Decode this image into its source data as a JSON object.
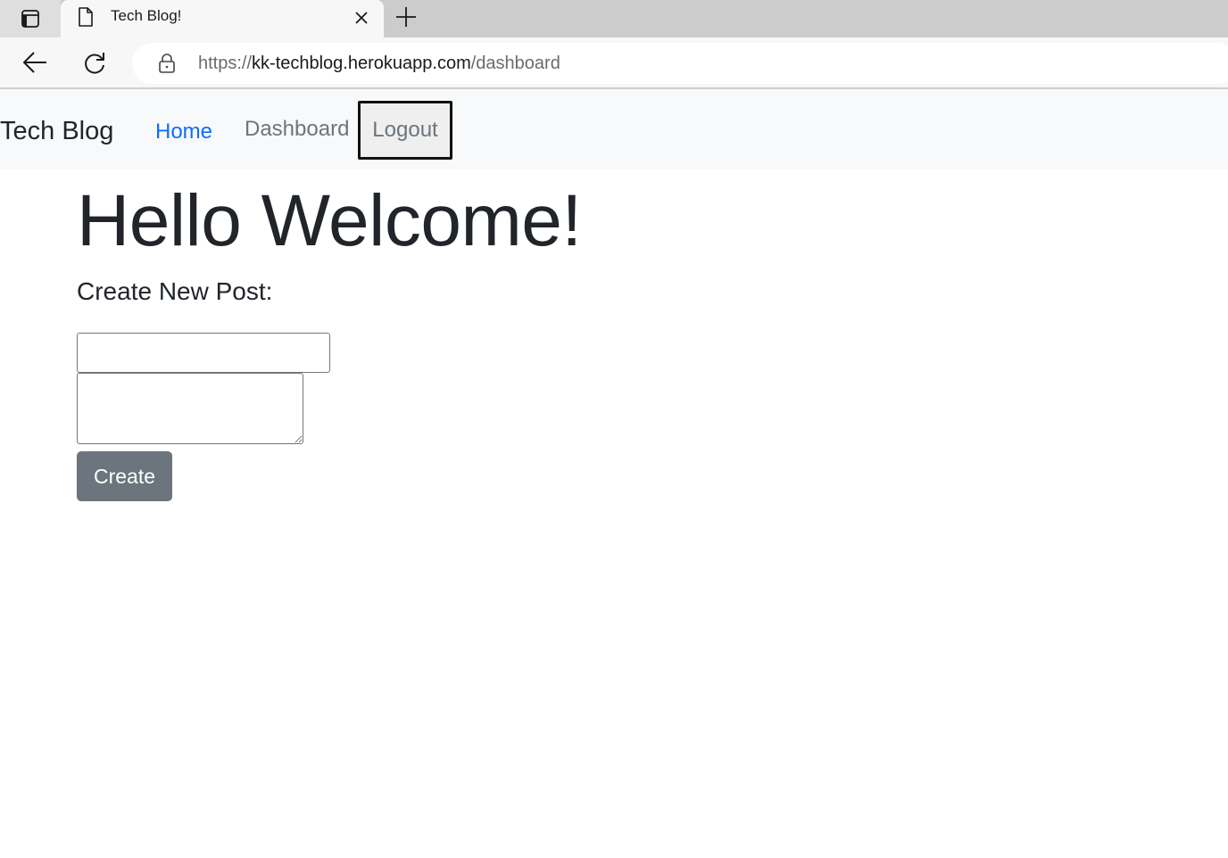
{
  "browser": {
    "tab_title": "Tech Blog!",
    "url_scheme": "https://",
    "url_host": "kk-techblog.herokuapp.com",
    "url_path": "/dashboard"
  },
  "navbar": {
    "brand": "Tech Blog",
    "links": [
      {
        "label": "Home",
        "active": true
      },
      {
        "label": "Dashboard",
        "active": false
      }
    ],
    "logout_label": "Logout"
  },
  "main": {
    "heading": "Hello Welcome!",
    "form_title": "Create New Post:",
    "title_input_value": "",
    "body_textarea_value": "",
    "submit_label": "Create"
  },
  "colors": {
    "link_active": "#0d6efd",
    "link_muted": "#6c757d",
    "navbar_bg": "#f8f9fa",
    "button_secondary": "#6c757d"
  },
  "icons": {
    "tab_actions": "tab-actions-icon",
    "favicon": "page-document-icon",
    "tab_close": "close-icon",
    "new_tab": "plus-icon",
    "back": "back-arrow-icon",
    "reload": "reload-icon",
    "lock": "lock-icon"
  }
}
